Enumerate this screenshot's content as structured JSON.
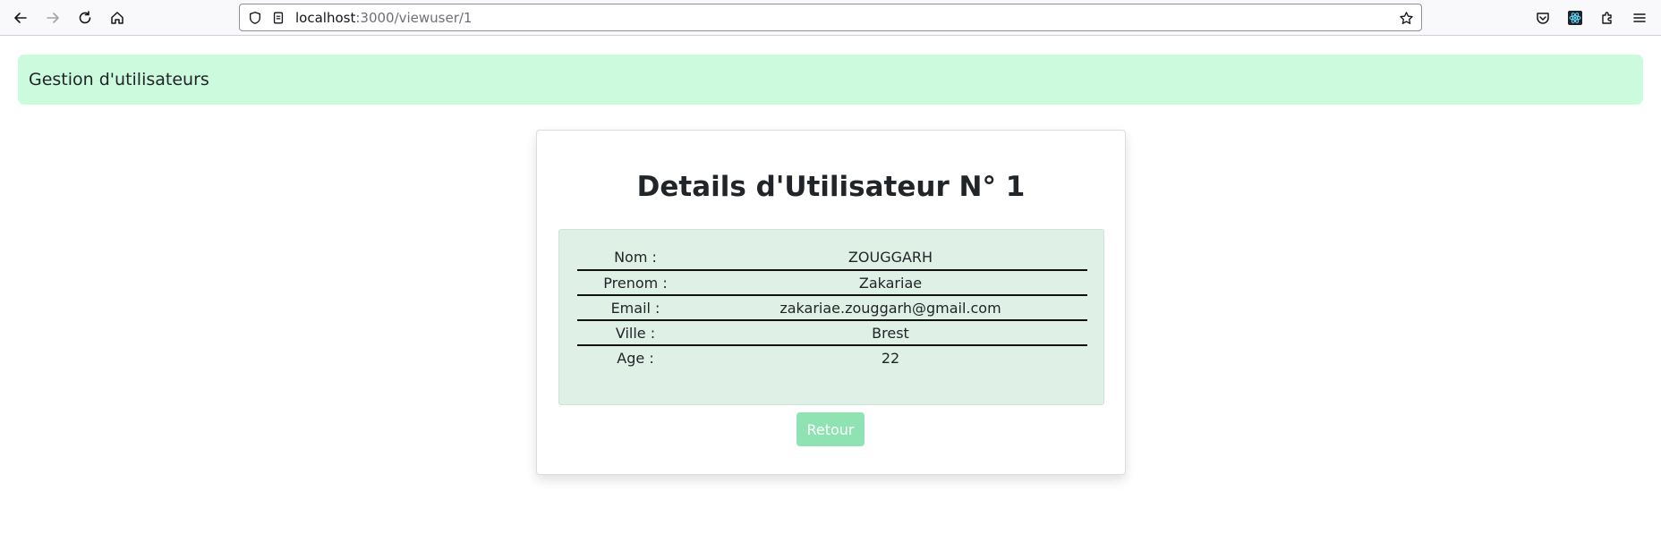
{
  "browser": {
    "url_host": "localhost",
    "url_path": ":3000/viewuser/1",
    "icons": [
      "back-arrow-icon",
      "forward-arrow-icon",
      "reload-icon",
      "home-icon",
      "shield-icon",
      "page-icon",
      "bookmark-star-icon",
      "pocket-icon",
      "react-devtools-icon",
      "extensions-icon",
      "menu-icon"
    ]
  },
  "navbar": {
    "brand": "Gestion d'utilisateurs"
  },
  "card": {
    "title": "Details d'Utilisateur N° 1",
    "rows": [
      {
        "label": "Nom :",
        "value": "ZOUGGARH"
      },
      {
        "label": "Prenom :",
        "value": "Zakariae"
      },
      {
        "label": "Email :",
        "value": "zakariae.zouggarh@gmail.com"
      },
      {
        "label": "Ville :",
        "value": "Brest"
      },
      {
        "label": "Age :",
        "value": "22"
      }
    ],
    "button_label": "Retour"
  },
  "colors": {
    "navbar_bg": "#ccfadd",
    "details_bg": "#dff0e6",
    "button_bg": "#8fe3b2"
  }
}
